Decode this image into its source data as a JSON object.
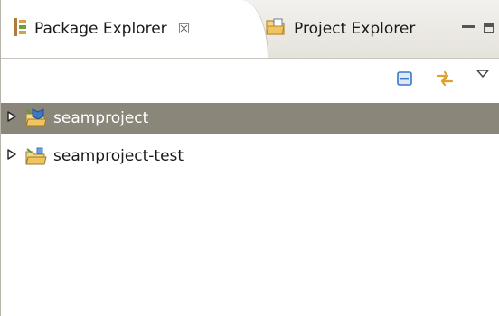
{
  "tabs": [
    {
      "label": "Package Explorer",
      "close_symbol": "☒",
      "active": true,
      "icon": "package-explorer-icon"
    },
    {
      "label": "Project Explorer",
      "active": false,
      "icon": "project-explorer-icon"
    }
  ],
  "toolbar": {
    "buttons": [
      {
        "icon": "collapse-all-icon"
      },
      {
        "icon": "link-with-editor-icon"
      },
      {
        "icon": "view-menu-icon"
      }
    ]
  },
  "tree": {
    "items": [
      {
        "label": "seamproject",
        "selected": true,
        "expanded": false,
        "icon": "seam-project-icon"
      },
      {
        "label": "seamproject-test",
        "selected": false,
        "expanded": false,
        "icon": "project-folder-icon"
      }
    ]
  },
  "colors": {
    "selection": "#8b867a",
    "tab_bar": "#e6e3dd",
    "accent_blue": "#3a78c8",
    "accent_orange": "#e0a030"
  }
}
